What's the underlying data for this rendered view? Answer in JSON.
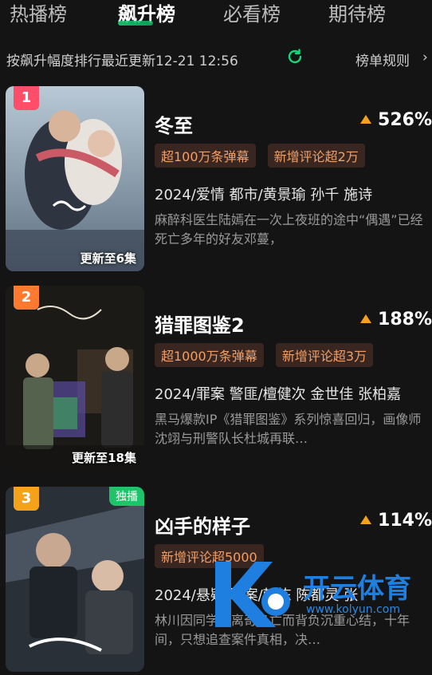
{
  "tabs": [
    {
      "label": "热播榜",
      "active": false
    },
    {
      "label": "飙升榜",
      "active": true
    },
    {
      "label": "必看榜",
      "active": false
    },
    {
      "label": "期待榜",
      "active": false
    }
  ],
  "subheader": {
    "update_text": "按飙升幅度排行最近更新12-21 12:56",
    "refresh_icon": "refresh-icon",
    "rules_label": "榜单规则",
    "rules_chevron": "›"
  },
  "items": [
    {
      "rank": "1",
      "title": "冬至",
      "rise": "526%",
      "tags": [
        "超100万条弹幕",
        "新增评论超2万"
      ],
      "meta": "2024/爱情 都市/黄景瑜 孙千 施诗",
      "desc": "麻醉科医生陆嫣在一次上夜班的途中“偶遇”已经死亡多年的好友邓蔓，",
      "episodes": "更新至6集",
      "exclusive": ""
    },
    {
      "rank": "2",
      "title": "猎罪图鉴2",
      "rise": "188%",
      "tags": [
        "超1000万条弹幕",
        "新增评论超3万"
      ],
      "meta": "2024/罪案 警匪/檀健次 金世佳 张柏嘉",
      "desc": "黑马爆款IP《猎罪图鉴》系列惊喜回归，画像师沈翊与刑警队长杜城再联…",
      "episodes": "更新至18集",
      "exclusive": ""
    },
    {
      "rank": "3",
      "title": "凶手的样子",
      "rise": "114%",
      "tags": [
        "新增评论超5000"
      ],
      "meta": "2024/悬疑 罪案/韩栋 陈都灵 张",
      "desc": "林川因同学的离奇身亡而背负沉重心结，十年间，只想追查案件真相，决…",
      "episodes": "",
      "exclusive": "独播"
    }
  ],
  "colors": {
    "background": "#141414",
    "accent_green": "#17d77a",
    "rise_arrow": "#f5a21b",
    "tag_text": "#f0a068",
    "tag_bg": "#3a2620",
    "rank1": "#ff4d6a",
    "rank2": "#ff7a2e",
    "rank3": "#f5a21b"
  },
  "watermark": {
    "text": "开云体育",
    "url": "www.kolyun.com"
  }
}
